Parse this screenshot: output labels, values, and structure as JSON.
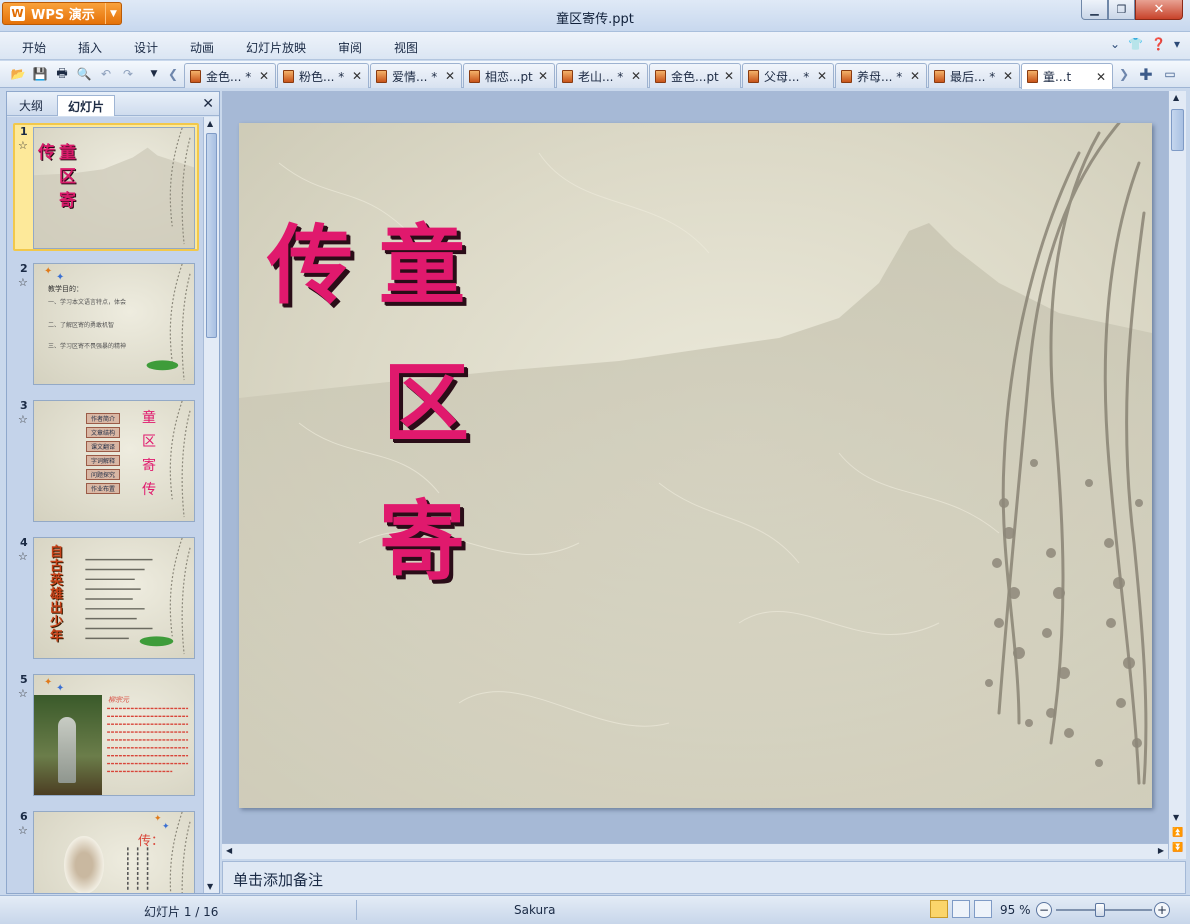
{
  "app": {
    "name": "WPS 演示",
    "window_title": "童区寄传.ppt"
  },
  "menu": [
    "开始",
    "插入",
    "设计",
    "动画",
    "幻灯片放映",
    "审阅",
    "视图"
  ],
  "doc_tabs": [
    "金色... *",
    "粉色... *",
    "爱情... *",
    "相恋...pt",
    "老山... *",
    "金色...pt",
    "父母... *",
    "养母... *",
    "最后... *",
    "童...t"
  ],
  "left_panel": {
    "tab_outline": "大纲",
    "tab_slides": "幻灯片"
  },
  "thumbnails": [
    {
      "num": "1",
      "chars": [
        "传",
        "童",
        "区",
        "寄"
      ]
    },
    {
      "num": "2",
      "title": "教学目的：",
      "lines": [
        "一、学习本文语言特点，体会",
        "二、了解区寄的勇敢机智",
        "三、学习区寄不畏强暴的精神"
      ]
    },
    {
      "num": "3",
      "menu": [
        "作者简介",
        "文章结构",
        "课文翻译",
        "字词解释",
        "问题探究",
        "作业布置"
      ],
      "chars": [
        "童",
        "区",
        "寄",
        "传"
      ]
    },
    {
      "num": "4",
      "title_vertical": "自古英雄出少年"
    },
    {
      "num": "5",
      "name": "柳宗元"
    },
    {
      "num": "6",
      "title": "传："
    }
  ],
  "main_slide": {
    "title_chars": [
      "传",
      "童",
      "区",
      "寄"
    ]
  },
  "notes_placeholder": "单击添加备注",
  "status": {
    "slide_counter": "幻灯片 1 / 16",
    "theme": "Sakura",
    "zoom": "95 %"
  }
}
